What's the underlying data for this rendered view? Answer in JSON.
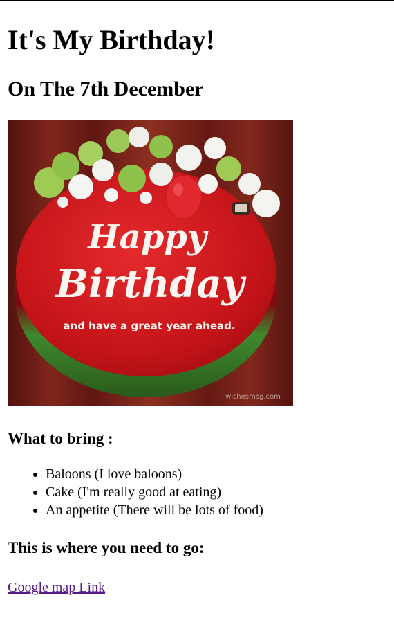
{
  "page": {
    "title": "It's My Birthday!",
    "subtitle": "On The 7th December"
  },
  "image": {
    "icon": "birthday-cake-image",
    "text_line1": "Happy",
    "text_line2": "Birthday",
    "text_line3": "and have a great year ahead.",
    "watermark": "wishesmsg.com",
    "colors": {
      "cake_red": "#c8141e",
      "background_wood": "#7a1e16",
      "meringue_green": "#8fc24a",
      "meringue_white": "#f2f2ee",
      "raspberry": "#e0282e"
    }
  },
  "bring": {
    "heading": "What to bring :",
    "items": [
      "Baloons (I love baloons)",
      "Cake (I'm really good at eating)",
      "An appetite (There will be lots of food)"
    ]
  },
  "location": {
    "heading": "This is where you need to go:",
    "link_text": "Google map Link",
    "link_color": "#551a8b"
  }
}
